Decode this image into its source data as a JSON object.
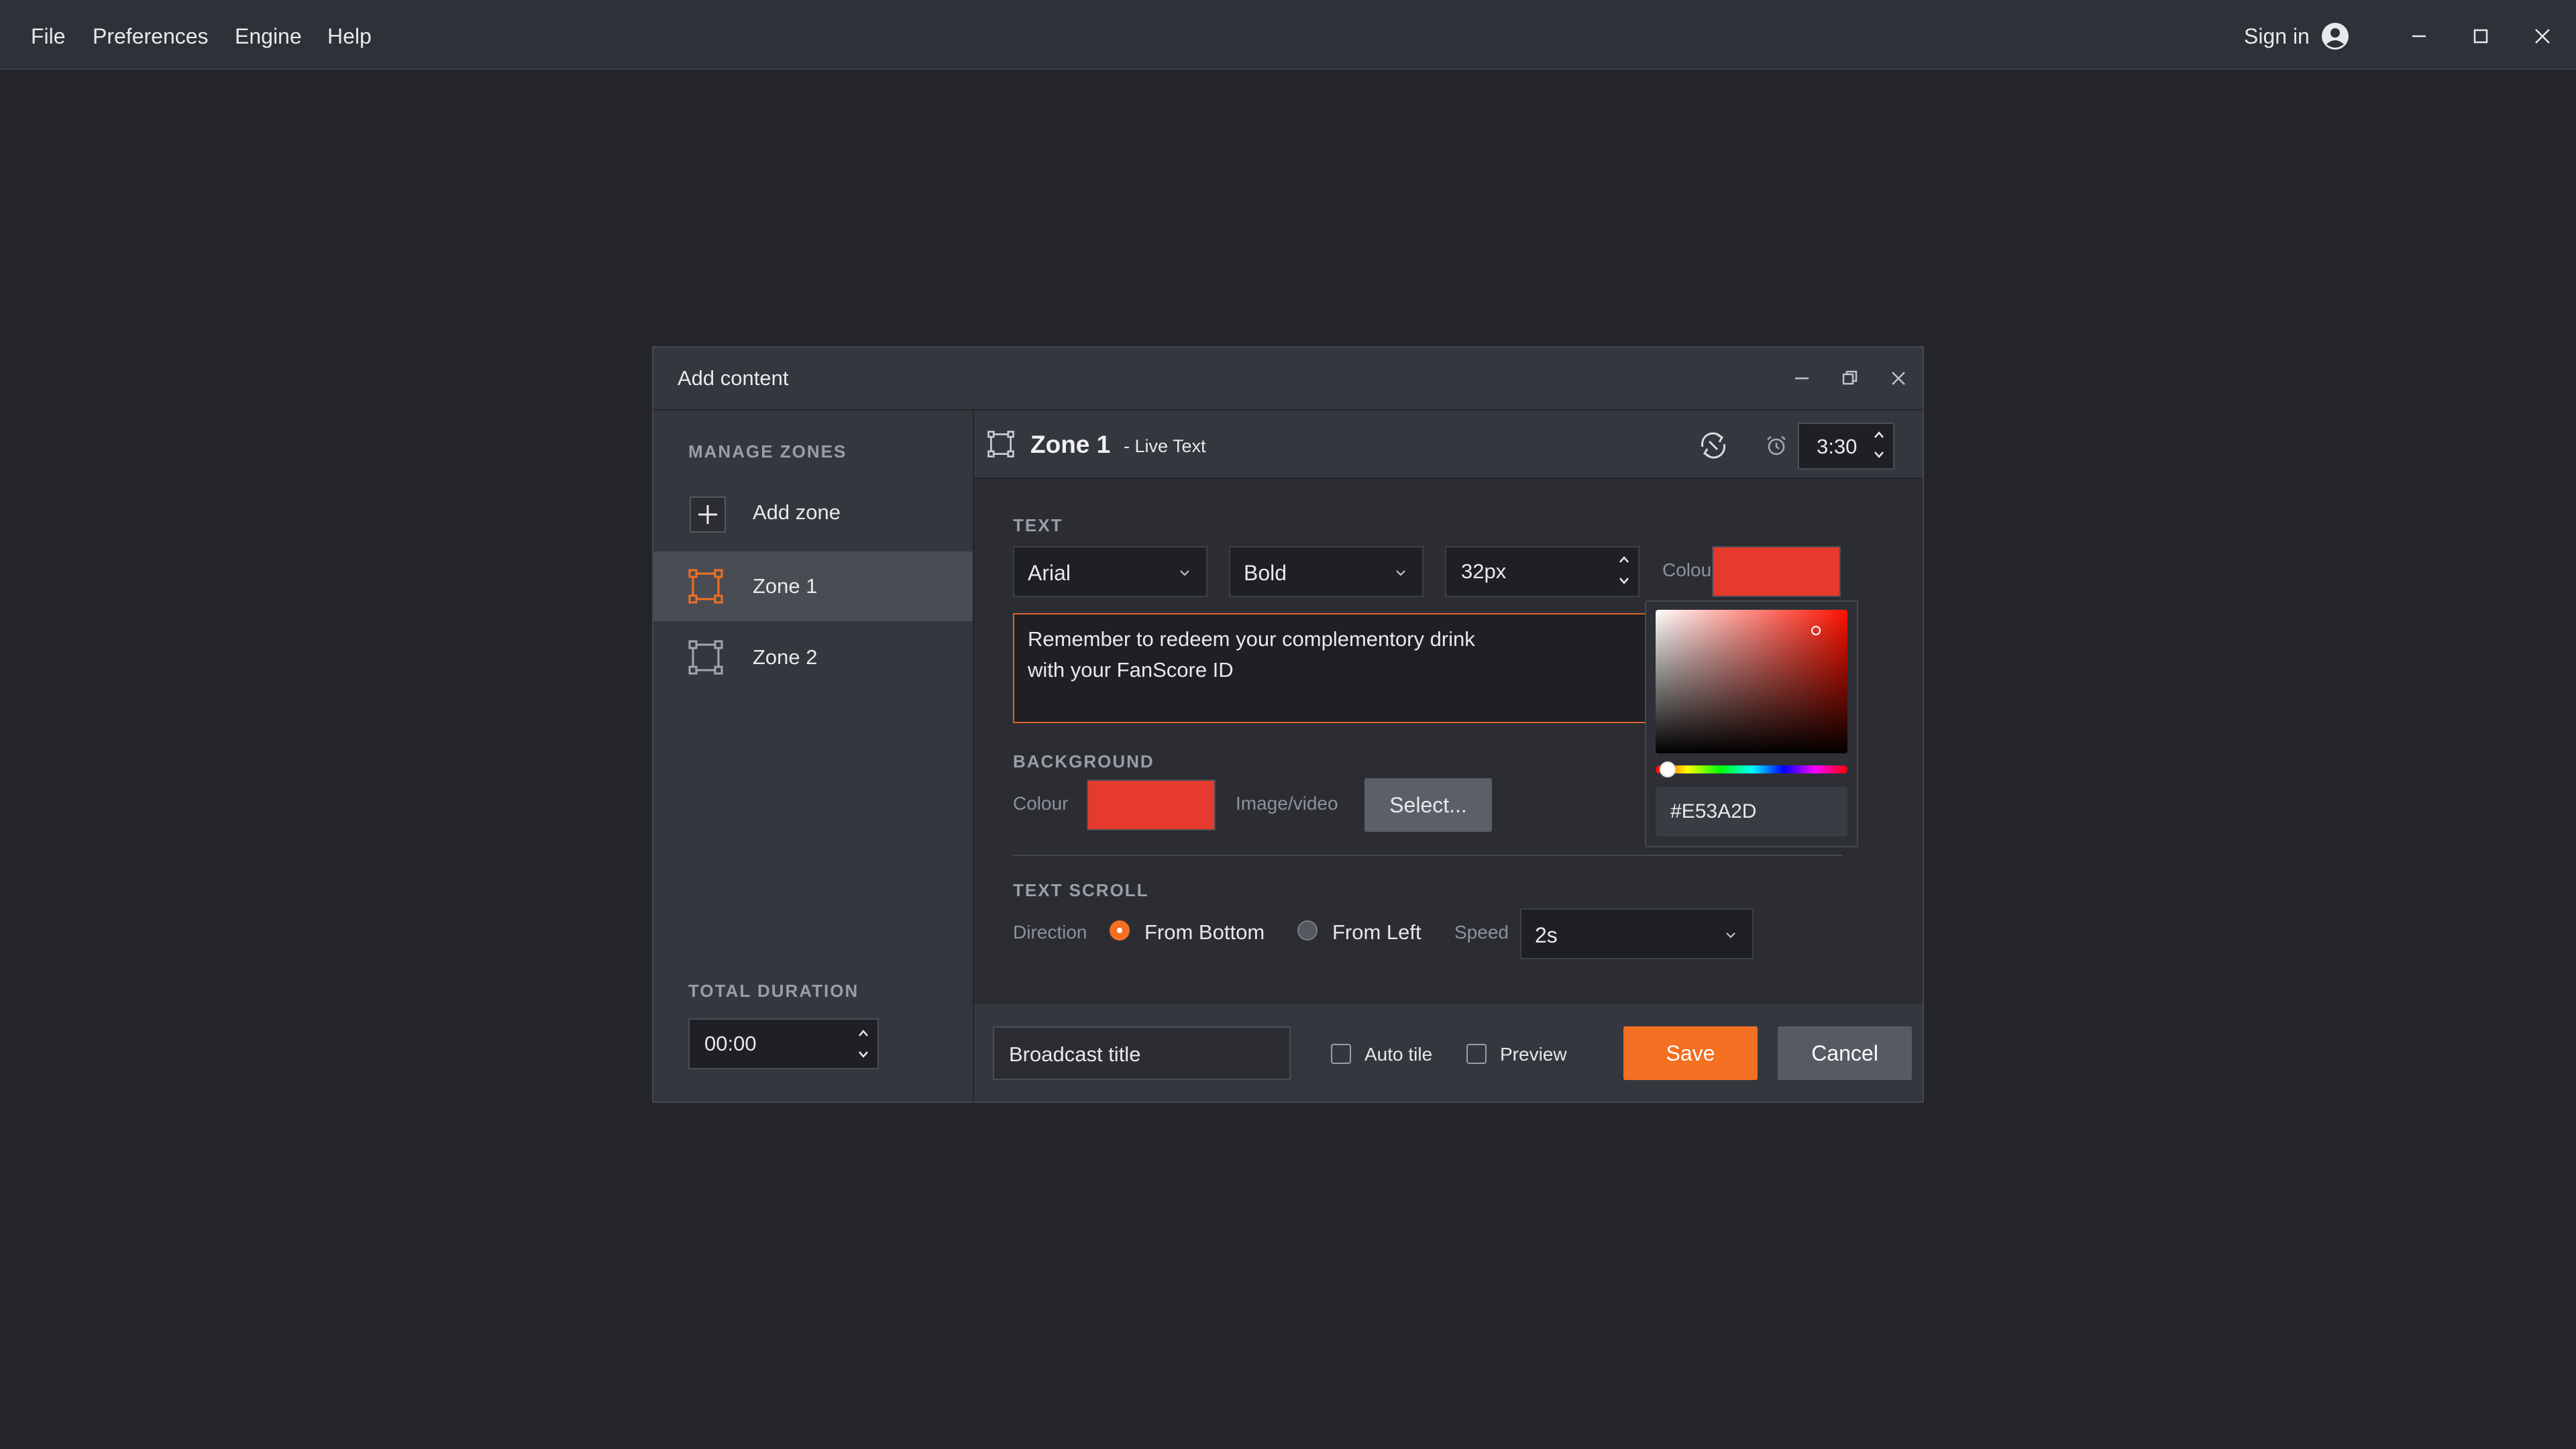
{
  "menubar": {
    "items": [
      "File",
      "Preferences",
      "Engine",
      "Help"
    ],
    "signin_label": "Sign in"
  },
  "dialog": {
    "title": "Add content"
  },
  "sidebar": {
    "manage_zones_label": "MANAGE ZONES",
    "add_zone_label": "Add zone",
    "zones": [
      "Zone 1",
      "Zone 2"
    ],
    "active_zone": "Zone 1",
    "total_duration_label": "TOTAL DURATION",
    "total_duration_value": "00:00"
  },
  "header": {
    "zone_name": "Zone 1",
    "zone_type": "- Live Text",
    "duration": "3:30"
  },
  "text_section": {
    "label": "TEXT",
    "font": "Arial",
    "weight": "Bold",
    "size": "32px",
    "colour_label": "Colour",
    "colour": "#E53A2D",
    "content_line1": "Remember to redeem your complementory drink",
    "content_line2": "with your FanScore ID"
  },
  "background_section": {
    "label": "BACKGROUND",
    "colour_label": "Colour",
    "colour": "#E53A2D",
    "media_label": "Image/video",
    "select_button": "Select..."
  },
  "scroll_section": {
    "label": "TEXT SCROLL",
    "direction_label": "Direction",
    "option_bottom": "From Bottom",
    "option_left": "From Left",
    "selected": "From Bottom",
    "speed_label": "Speed",
    "speed": "2s"
  },
  "footer": {
    "broadcast_title": "Broadcast title",
    "auto_tile_label": "Auto tile",
    "auto_tile_checked": false,
    "preview_label": "Preview",
    "preview_checked": false,
    "save_label": "Save",
    "cancel_label": "Cancel"
  },
  "color_picker": {
    "hex_value": "#E53A2D",
    "hue_fraction": 0.02
  },
  "colors": {
    "accent": "#F36F21",
    "app_bg": "#23252B",
    "panel_bg": "#2B2D33",
    "chrome_bg": "#35373E"
  }
}
